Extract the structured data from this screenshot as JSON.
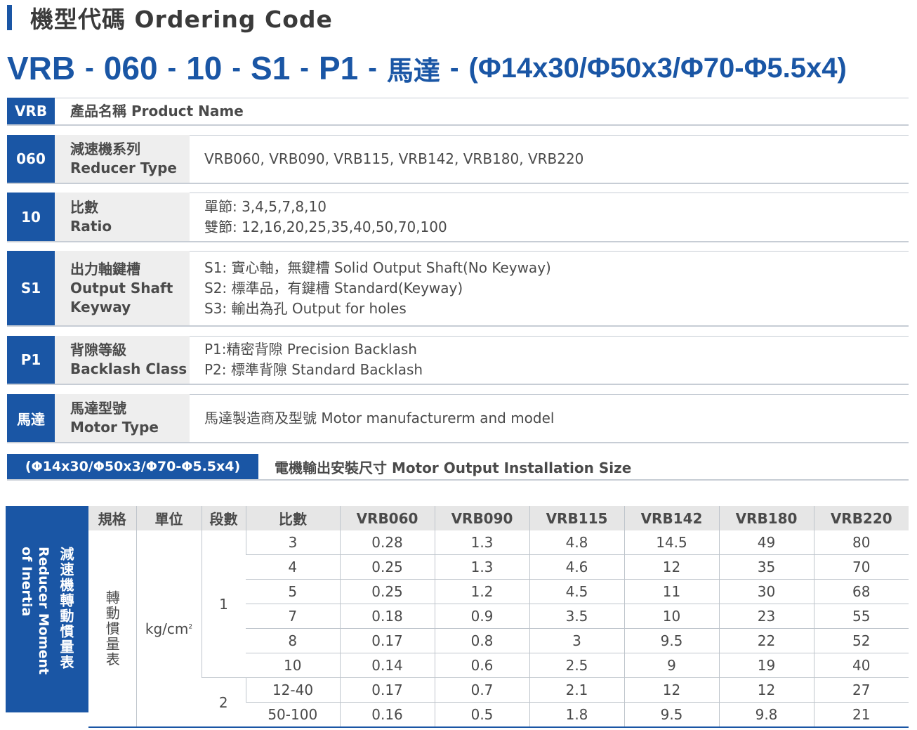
{
  "section": {
    "title": "機型代碼 Ordering Code"
  },
  "code_line": {
    "segments": [
      "VRB",
      "060",
      "10",
      "S1",
      "P1",
      "馬達",
      "(Φ14x30/Φ50x3/Φ70-Φ5.5x4)"
    ],
    "separator": "-"
  },
  "options": [
    {
      "code": "VRB",
      "name_cn": "產品名稱",
      "name_en": "Product Name",
      "desc": []
    },
    {
      "code": "060",
      "name_cn": "減速機系列",
      "name_en": "Reducer Type",
      "desc": [
        "VRB060, VRB090, VRB115, VRB142, VRB180, VRB220"
      ]
    },
    {
      "code": "10",
      "name_cn": "比數",
      "name_en": "Ratio",
      "desc": [
        "單節: 3,4,5,7,8,10",
        "雙節: 12,16,20,25,35,40,50,70,100"
      ]
    },
    {
      "code": "S1",
      "name_cn": "出力軸鍵槽",
      "name_en": "Output Shaft",
      "name_en2": "Keyway",
      "desc": [
        "S1: 實心軸，無鍵槽  Solid Output Shaft(No Keyway)",
        "S2: 標準品，有鍵槽  Standard(Keyway)",
        "S3: 輸出為孔  Output for holes"
      ]
    },
    {
      "code": "P1",
      "name_cn": "背隙等級",
      "name_en": "Backlash Class",
      "desc": [
        "P1:精密背隙 Precision Backlash",
        "P2: 標準背隙 Standard Backlash"
      ]
    },
    {
      "code": "馬達",
      "name_cn": "馬達型號",
      "name_en": "Motor Type",
      "desc": [
        "馬達製造商及型號 Motor manufacturerm and model"
      ]
    }
  ],
  "size_row": {
    "code": "(Φ14x30/Φ50x3/Φ70-Φ5.5x4)",
    "label": "電機輸出安裝尺寸 Motor Output Installation Size"
  },
  "inertia": {
    "side_cn": "減速機轉動慣量表",
    "side_en1": "Reducer Moment",
    "side_en2": "of Inertia",
    "headers": [
      "規格",
      "單位",
      "段數",
      "比數",
      "VRB060",
      "VRB090",
      "VRB115",
      "VRB142",
      "VRB180",
      "VRB220"
    ],
    "spec_label": "轉動慣量表",
    "unit": "kg/cm",
    "unit_sup": "2",
    "stage1": "1",
    "stage2": "2",
    "rows": [
      [
        "3",
        "0.28",
        "1.3",
        "4.8",
        "14.5",
        "49",
        "80"
      ],
      [
        "4",
        "0.25",
        "1.3",
        "4.6",
        "12",
        "35",
        "70"
      ],
      [
        "5",
        "0.25",
        "1.2",
        "4.5",
        "11",
        "30",
        "68"
      ],
      [
        "7",
        "0.18",
        "0.9",
        "3.5",
        "10",
        "23",
        "55"
      ],
      [
        "8",
        "0.17",
        "0.8",
        "3",
        "9.5",
        "22",
        "52"
      ],
      [
        "10",
        "0.14",
        "0.6",
        "2.5",
        "9",
        "19",
        "40"
      ],
      [
        "12-40",
        "0.17",
        "0.7",
        "2.1",
        "12",
        "12",
        "27"
      ],
      [
        "50-100",
        "0.16",
        "0.5",
        "1.8",
        "9.5",
        "9.8",
        "21"
      ]
    ]
  }
}
